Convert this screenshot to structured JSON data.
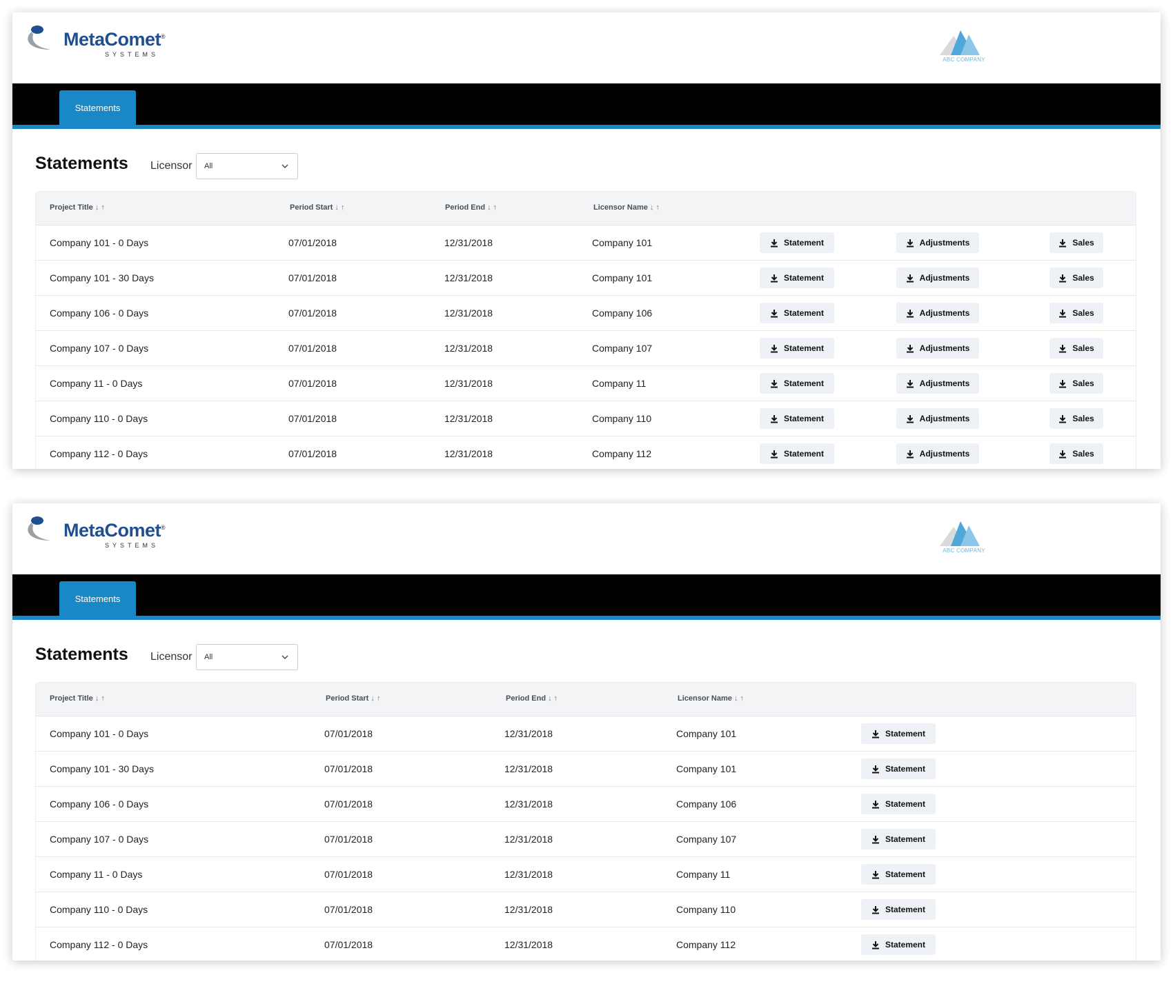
{
  "brand": {
    "name": "MetaComet",
    "registered": "®",
    "subtitle": "SYSTEMS"
  },
  "client_logo": {
    "text": "ABC COMPANY",
    "color": "#6fb6dd"
  },
  "nav": {
    "tab_label": "Statements",
    "accent": "#1a88c7"
  },
  "toolbar": {
    "title": "Statements",
    "licensor_label": "Licensor",
    "licensor_value": "All"
  },
  "table": {
    "columns": {
      "project_title": "Project Title",
      "period_start": "Period Start",
      "period_end": "Period End",
      "licensor_name": "Licensor Name",
      "sort_glyphs": "↓ ↑"
    },
    "buttons": {
      "statement": "Statement",
      "adjustments": "Adjustments",
      "sales": "Sales"
    },
    "rows": [
      {
        "project": "Company 101 - 0 Days",
        "start": "07/01/2018",
        "end": "12/31/2018",
        "licensor": "Company 101"
      },
      {
        "project": "Company 101 - 30 Days",
        "start": "07/01/2018",
        "end": "12/31/2018",
        "licensor": "Company 101"
      },
      {
        "project": "Company 106 - 0 Days",
        "start": "07/01/2018",
        "end": "12/31/2018",
        "licensor": "Company 106"
      },
      {
        "project": "Company 107 - 0 Days",
        "start": "07/01/2018",
        "end": "12/31/2018",
        "licensor": "Company 107"
      },
      {
        "project": "Company 11 - 0 Days",
        "start": "07/01/2018",
        "end": "12/31/2018",
        "licensor": "Company 11"
      },
      {
        "project": "Company 110 - 0 Days",
        "start": "07/01/2018",
        "end": "12/31/2018",
        "licensor": "Company 110"
      },
      {
        "project": "Company 112 - 0 Days",
        "start": "07/01/2018",
        "end": "12/31/2018",
        "licensor": "Company 112"
      }
    ]
  },
  "panels": [
    {
      "variant": "full",
      "buttons": [
        "statement",
        "adjustments",
        "sales"
      ]
    },
    {
      "variant": "statement-only",
      "buttons": [
        "statement"
      ]
    }
  ]
}
